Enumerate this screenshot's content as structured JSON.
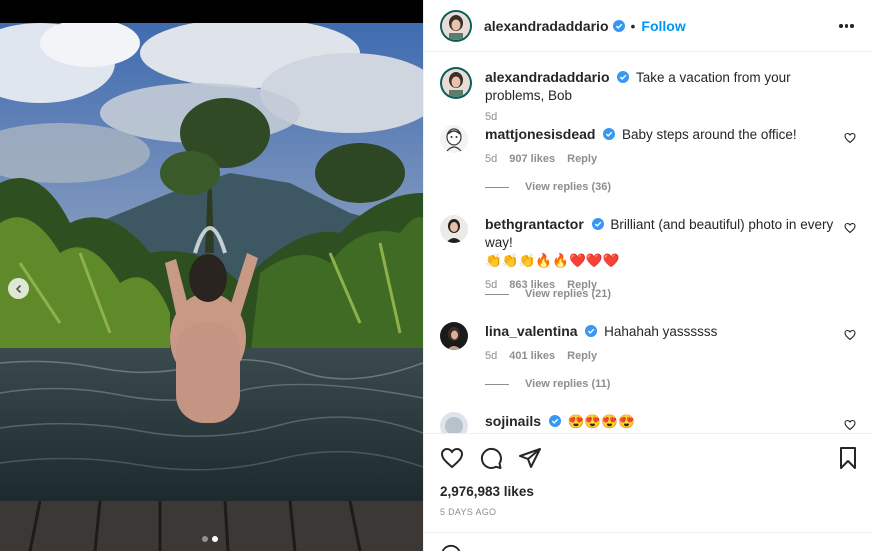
{
  "post": {
    "author": "alexandradaddario",
    "follow_label": "Follow",
    "separator": "•"
  },
  "comments": [
    {
      "user": "alexandradaddario",
      "text": "Take a vacation from your problems, Bob",
      "time": "5d"
    },
    {
      "user": "mattjonesisdead",
      "text": "Baby steps around the office!",
      "time": "5d",
      "likes": "907 likes",
      "reply_label": "Reply",
      "view_replies": "View replies (36)"
    },
    {
      "user": "bethgrantactor",
      "text": "Brilliant (and beautiful) photo in every way!",
      "text2": "👏👏👏🔥🔥❤️❤️❤️",
      "time": "5d",
      "likes": "863 likes",
      "reply_label": "Reply",
      "view_replies": "View replies (21)"
    },
    {
      "user": "lina_valentina",
      "text": "Hahahah yassssss",
      "time": "5d",
      "likes": "401 likes",
      "reply_label": "Reply",
      "view_replies": "View replies (11)"
    },
    {
      "user": "sojinails",
      "text": "😍😍😍😍"
    }
  ],
  "footer": {
    "likes": "2,976,983 likes",
    "posted": "5 DAYS AGO"
  },
  "icons": {
    "verified": "verified-badge-icon",
    "heart": "heart-icon",
    "comment": "comment-icon",
    "share": "share-icon",
    "bookmark": "bookmark-icon",
    "more": "more-options-icon",
    "carousel_prev": "chevron-left-icon"
  },
  "colors": {
    "follow_blue": "#0095f6",
    "verified_blue": "#3897f0",
    "muted_text": "#8e8e8e"
  }
}
